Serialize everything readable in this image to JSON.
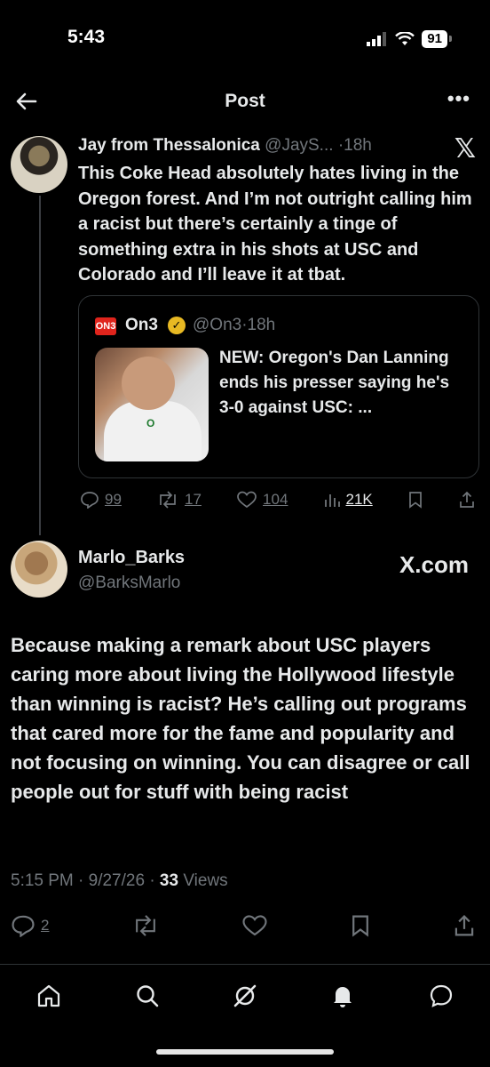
{
  "status": {
    "time": "5:43",
    "battery": "91"
  },
  "header": {
    "title": "Post"
  },
  "tweet": {
    "author_name": "Jay from Thessalonica",
    "handle": "@JayS...",
    "age": "18h",
    "separator": "·",
    "text": "This Coke Head absolutely hates living in the Oregon forest. And I’m not outright calling him a racist but there’s certainly a tinge of something extra in his shots at USC and Colorado and I’ll leave it at tbat.",
    "quote": {
      "logo": "ON3",
      "name": "On3",
      "handle": "@On3",
      "age": "18h",
      "text": "NEW: Oregon's Dan Lanning ends his presser saying he's 3-0 against USC: ...",
      "image_mark": "O"
    },
    "stats": {
      "replies": "99",
      "reposts": "17",
      "likes": "104",
      "views": "21K"
    }
  },
  "reply": {
    "name": "Marlo_Barks",
    "handle": "@BarksMarlo",
    "source": "X.com",
    "text": "Because making a remark about USC players caring more about living the Hollywood lifestyle than winning is racist? He’s calling out programs that cared more for the fame and popularity and not focusing on winning. You can disagree or call people out for stuff with being racist",
    "timestamp": "5:15 PM · 9/27/26 · ",
    "views_count": "33",
    "views_label": " Views",
    "stats": {
      "replies": "2"
    }
  },
  "nav": [
    "home",
    "search",
    "grok",
    "notifications",
    "messages"
  ]
}
